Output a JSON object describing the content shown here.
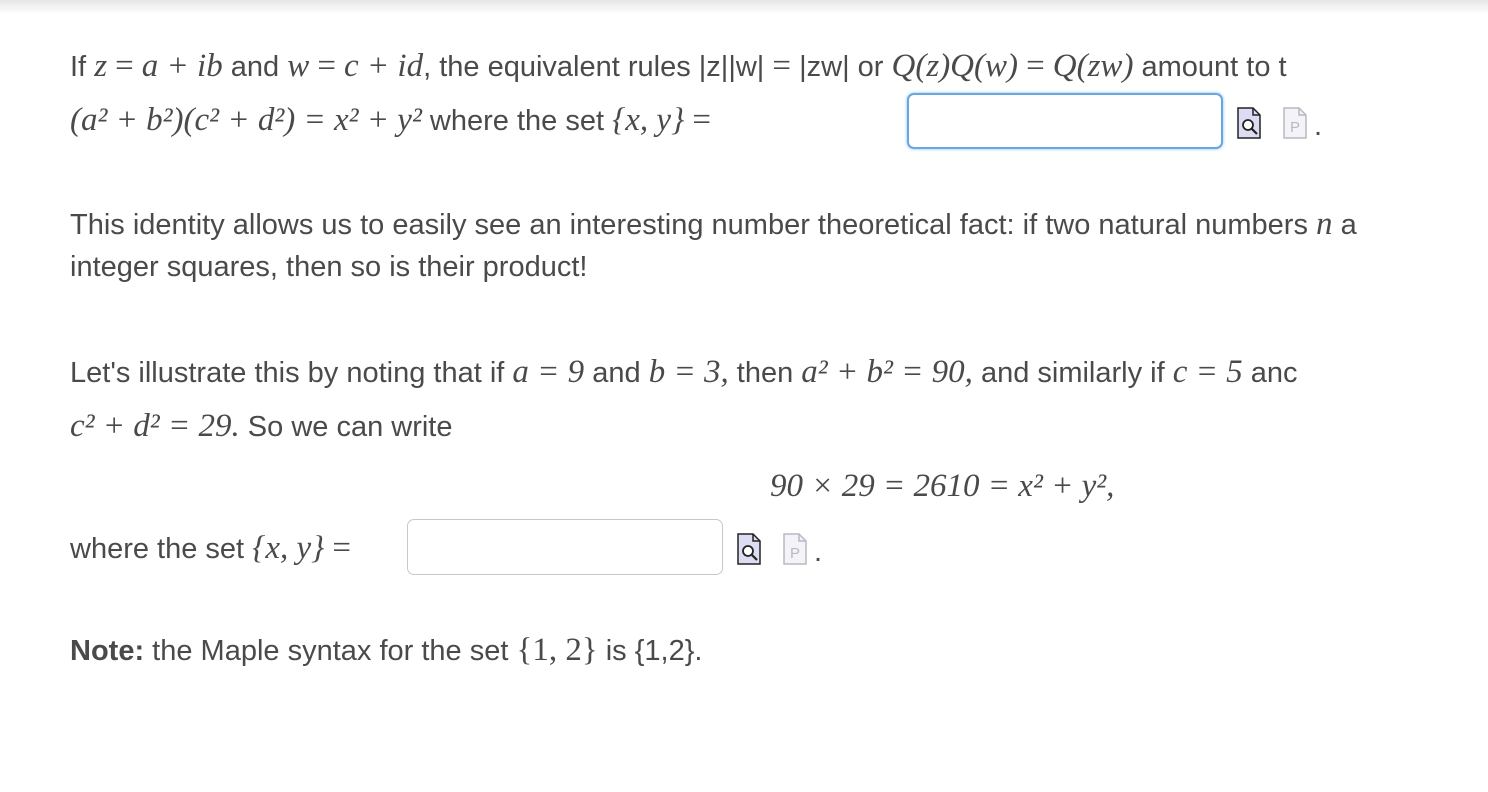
{
  "para1": {
    "t_if": "If",
    "z": "z",
    "eq": "=",
    "a_plus_ib": "a + ib",
    "t_and": "and",
    "w": "w",
    "c_plus_id": "c + id",
    "t_rules": ", the equivalent rules |z||w|",
    "zw_abs": "|zw|",
    "t_or": "or",
    "qzqw": "Q(z)Q(w)",
    "qzw": "Q(zw)",
    "t_amount": "amount to t",
    "line2_math": "(a² + b²)(c² + d²) = x² + y²",
    "t_where": "where the set",
    "set": "{x, y}",
    "answer_value": ""
  },
  "para2": {
    "line1": "This identity allows us to easily see an interesting number theoretical fact: if two natural numbers",
    "n": "n",
    "tail": "a",
    "line2": "integer squares, then so is their product!"
  },
  "para3": {
    "t_lets": "Let's illustrate this by noting that if",
    "a_eq": "a = 9",
    "t_and": "and",
    "b_eq": "b = 3,",
    "t_then": "then",
    "sum_ab": "a² + b² = 90,",
    "t_similarly": "and similarly if",
    "c_eq": "c = 5",
    "t_anc": "anc",
    "sum_cd": "c² + d² = 29.",
    "t_write": "So we can write",
    "display": "90 × 29 = 2610 = x² + y²,",
    "t_where": "where the set",
    "set": "{x, y}",
    "eq": "=",
    "answer_value": ""
  },
  "note": {
    "label": "Note:",
    "text": "the Maple syntax for the set",
    "set_math": "{1, 2}",
    "t_is": "is {1,2}."
  },
  "icons": {
    "preview": "preview-icon",
    "maple_p": "maple-syntax-icon"
  },
  "colors": {
    "focus_border": "#6aa7e0",
    "text": "#4a4a4a"
  }
}
